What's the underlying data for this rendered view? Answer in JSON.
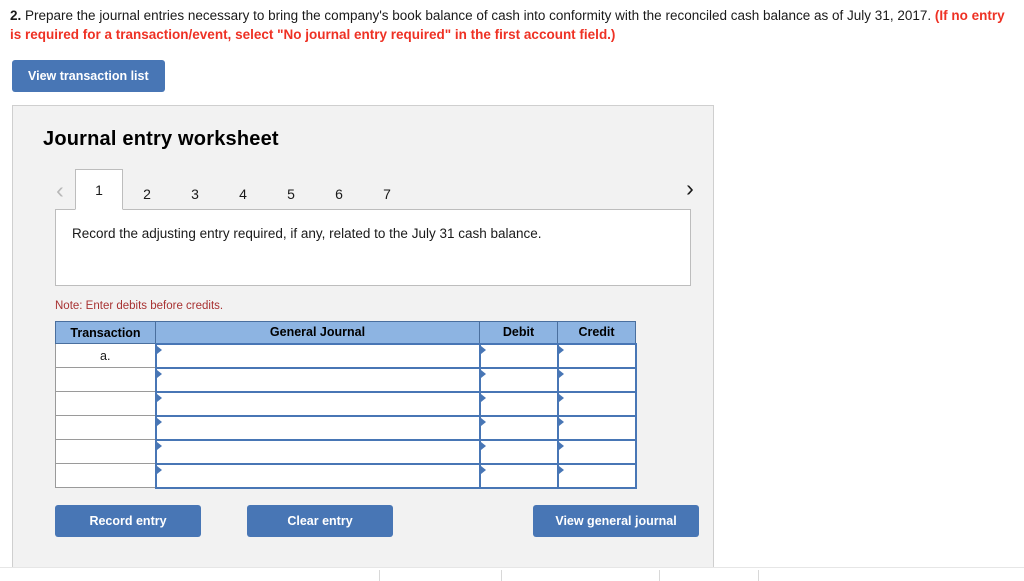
{
  "question": {
    "number": "2.",
    "text_line1": " Prepare the journal entries necessary to bring the company's book balance of cash into conformity with the reconciled cash balance as of July 31, 2017. ",
    "red_instruction": "(If no entry is required for a transaction/event, select \"No journal entry required\" in the first account field.)"
  },
  "toolbar": {
    "view_transaction_list": "View transaction list"
  },
  "panel": {
    "title": "Journal entry worksheet",
    "prev_chevron": "‹",
    "next_chevron": "›",
    "tabs": [
      {
        "label": "1",
        "active": true
      },
      {
        "label": "2",
        "active": false
      },
      {
        "label": "3",
        "active": false
      },
      {
        "label": "4",
        "active": false
      },
      {
        "label": "5",
        "active": false
      },
      {
        "label": "6",
        "active": false
      },
      {
        "label": "7",
        "active": false
      }
    ],
    "prompt": "Record the adjusting entry required, if any, related to the July 31 cash balance.",
    "note": "Note: Enter debits before credits."
  },
  "table": {
    "headers": {
      "transaction": "Transaction",
      "general_journal": "General Journal",
      "debit": "Debit",
      "credit": "Credit"
    },
    "rows": [
      {
        "transaction": "a.",
        "general_journal": "",
        "debit": "",
        "credit": ""
      },
      {
        "transaction": "",
        "general_journal": "",
        "debit": "",
        "credit": ""
      },
      {
        "transaction": "",
        "general_journal": "",
        "debit": "",
        "credit": ""
      },
      {
        "transaction": "",
        "general_journal": "",
        "debit": "",
        "credit": ""
      },
      {
        "transaction": "",
        "general_journal": "",
        "debit": "",
        "credit": ""
      },
      {
        "transaction": "",
        "general_journal": "",
        "debit": "",
        "credit": ""
      }
    ]
  },
  "footer": {
    "record_entry": "Record entry",
    "clear_entry": "Clear entry",
    "view_general_journal": "View general journal"
  },
  "colors": {
    "button_blue": "#4876b5",
    "table_header_blue": "#8db4e2",
    "red_instruction": "#ee3124",
    "note_red": "#a83232",
    "panel_bg": "#f2f2f2"
  }
}
